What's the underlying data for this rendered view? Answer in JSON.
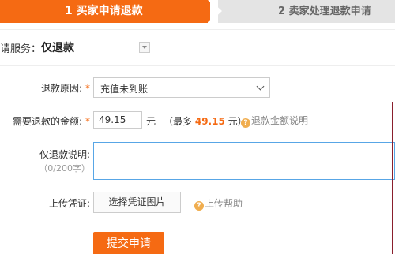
{
  "steps": {
    "active": "1 买家申请退款",
    "inactive": "2 卖家处理退款申请"
  },
  "service": {
    "label": "请服务：",
    "value": "仅退款"
  },
  "form": {
    "reason_label": "退款原因:",
    "reason_value": "充值未到账",
    "amount_label": "需要退款的金额:",
    "amount_value": "49.15",
    "currency": "元",
    "max_prefix": "（最多",
    "max_amount": "49.15",
    "max_suffix": "元）",
    "amount_help": "退款金额说明",
    "desc_label": "仅退款说明:",
    "desc_counter": "（0/200字）",
    "upload_label": "上传凭证:",
    "upload_button": "选择凭证图片",
    "upload_help": "上传帮助",
    "required_mark": "*",
    "submit": "提交申请"
  },
  "colors": {
    "accent": "#f56a13",
    "step_inactive": "#e4e4e4",
    "focus_border": "#58a6e6"
  }
}
